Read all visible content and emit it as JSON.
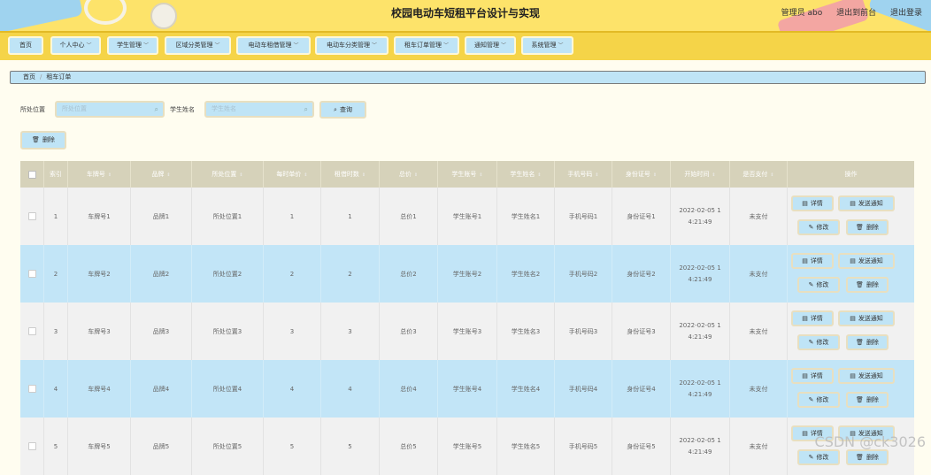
{
  "header": {
    "title": "校园电动车短租平台设计与实现",
    "user_label": "管理员 abo",
    "front_link": "退出到前台",
    "logout_link": "退出登录"
  },
  "nav": [
    {
      "label": "首页",
      "dropdown": false
    },
    {
      "label": "个人中心",
      "dropdown": true
    },
    {
      "label": "学生管理",
      "dropdown": true
    },
    {
      "label": "区域分类管理",
      "dropdown": true
    },
    {
      "label": "电动车租借管理",
      "dropdown": true
    },
    {
      "label": "电动车分类管理",
      "dropdown": true
    },
    {
      "label": "租车订单管理",
      "dropdown": true
    },
    {
      "label": "通知管理",
      "dropdown": true
    },
    {
      "label": "系统管理",
      "dropdown": true
    }
  ],
  "breadcrumb": {
    "home": "首页",
    "separator": "/",
    "current": "租车订单"
  },
  "search": {
    "location_label": "所处位置",
    "location_placeholder": "所处位置",
    "student_label": "学生姓名",
    "student_placeholder": "学生姓名",
    "query_button": "查询"
  },
  "toolbar": {
    "delete_button": "删除"
  },
  "table": {
    "columns": [
      "索引",
      "车牌号",
      "品牌",
      "所处位置",
      "每时单价",
      "租借时数",
      "总价",
      "学生账号",
      "学生姓名",
      "手机号码",
      "身份证号",
      "开始时间",
      "是否支付",
      "操作"
    ],
    "rows": [
      {
        "index": "1",
        "plate": "车牌号1",
        "brand": "品牌1",
        "location": "所处位置1",
        "price": "1",
        "hours": "1",
        "total": "总价1",
        "account": "学生账号1",
        "name": "学生姓名1",
        "phone": "手机号码1",
        "id_card": "身份证号1",
        "time_a": "2022-02-05 1",
        "time_b": "4:21:49",
        "paid": "未支付"
      },
      {
        "index": "2",
        "plate": "车牌号2",
        "brand": "品牌2",
        "location": "所处位置2",
        "price": "2",
        "hours": "2",
        "total": "总价2",
        "account": "学生账号2",
        "name": "学生姓名2",
        "phone": "手机号码2",
        "id_card": "身份证号2",
        "time_a": "2022-02-05 1",
        "time_b": "4:21:49",
        "paid": "未支付"
      },
      {
        "index": "3",
        "plate": "车牌号3",
        "brand": "品牌3",
        "location": "所处位置3",
        "price": "3",
        "hours": "3",
        "total": "总价3",
        "account": "学生账号3",
        "name": "学生姓名3",
        "phone": "手机号码3",
        "id_card": "身份证号3",
        "time_a": "2022-02-05 1",
        "time_b": "4:21:49",
        "paid": "未支付"
      },
      {
        "index": "4",
        "plate": "车牌号4",
        "brand": "品牌4",
        "location": "所处位置4",
        "price": "4",
        "hours": "4",
        "total": "总价4",
        "account": "学生账号4",
        "name": "学生姓名4",
        "phone": "手机号码4",
        "id_card": "身份证号4",
        "time_a": "2022-02-05 1",
        "time_b": "4:21:49",
        "paid": "未支付"
      },
      {
        "index": "5",
        "plate": "车牌号5",
        "brand": "品牌5",
        "location": "所处位置5",
        "price": "5",
        "hours": "5",
        "total": "总价5",
        "account": "学生账号5",
        "name": "学生姓名5",
        "phone": "手机号码5",
        "id_card": "身份证号5",
        "time_a": "2022-02-05 1",
        "time_b": "4:21:49",
        "paid": "未支付"
      }
    ],
    "actions": {
      "detail": "详情",
      "notify": "发送通知",
      "edit": "修改",
      "delete": "删除"
    }
  },
  "icons": {
    "search": "search-icon",
    "query": "search-icon",
    "delete": "trash-icon",
    "detail": "document-icon",
    "notify": "send-icon",
    "edit": "pencil-icon",
    "sort": "sort-icon",
    "dropdown": "chevron-down-icon"
  },
  "colors": {
    "header": "#fde36a",
    "navbar": "#f5d448",
    "button": "#bfe4f6",
    "row_alt": "#c2e5f7",
    "row": "#f1f1f1",
    "table_header": "#d6d2ba",
    "background": "#fffdf0"
  },
  "watermark": "CSDN @ck3026"
}
